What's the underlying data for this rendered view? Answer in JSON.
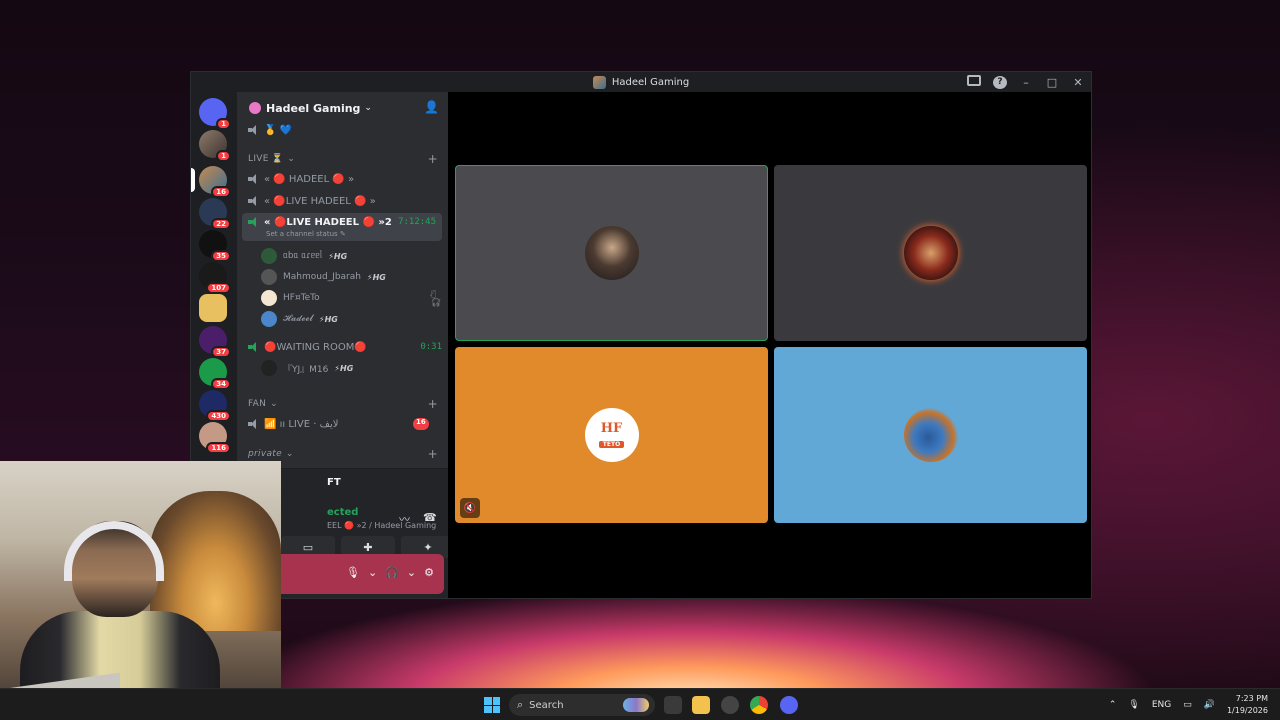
{
  "window": {
    "title": "Hadeel Gaming"
  },
  "rail": {
    "badges": [
      "1",
      "1",
      "16",
      "22",
      "35",
      "107",
      "",
      "37",
      "34",
      "430",
      "116"
    ]
  },
  "guild": {
    "name": "Hadeel Gaming"
  },
  "categories": {
    "live": "LIVE ⏳",
    "fan": "FAN",
    "private": "private"
  },
  "channels": {
    "c1": "« 🔴 HADEEL 🔴 »",
    "c2": "« 🔴LIVE HADEEL 🔴 »",
    "c3": "« 🔴LIVE HADEEL 🔴 »2",
    "c3_timer": "7:12:45",
    "c3_status": "Set a channel status ✎",
    "c4": "🔴WAITING ROOM🔴",
    "c4_timer": "0:31",
    "c5": "📶 ıı LIVE · لايف",
    "c5_badge": "16"
  },
  "users": {
    "u1": "ᥲbᥲ ᥲɾᥱᥱᥣ",
    "u2": "Mahmoud_Jbarah",
    "u3": "HF¤TeTo",
    "u4": "𝓗𝓪𝓭𝓮𝓮𝓵",
    "u5": "『YJ』M16",
    "tag": "⚡HG"
  },
  "voice_panel": {
    "name": "FT",
    "connected": "ected",
    "sub": "EEL 🔴 »2 / Hadeel Gaming"
  },
  "stage": {
    "hf_logo": "HF",
    "hf_sub": "TETO"
  },
  "taskbar": {
    "search": "Search",
    "lang": "ENG",
    "time": "7:23 PM",
    "date": "1/19/2026"
  },
  "colors": {
    "accent_green": "#23a559",
    "live_red": "#e0405e",
    "userbar": "#a7334f"
  }
}
